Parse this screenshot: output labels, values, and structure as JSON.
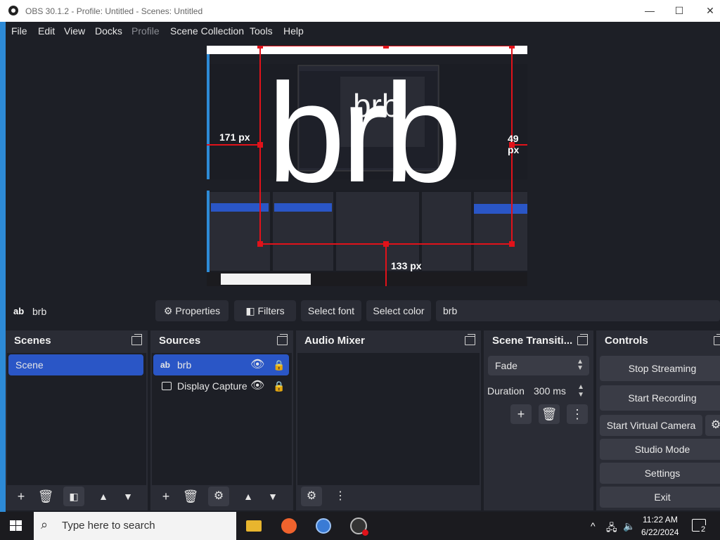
{
  "window": {
    "title": "OBS 30.1.2 - Profile: Untitled - Scenes: Untitled",
    "controls": [
      "—",
      "☐",
      "✕"
    ]
  },
  "menu": [
    "File",
    "Edit",
    "View",
    "Docks",
    "Profile",
    "Scene Collection",
    "Tools",
    "Help"
  ],
  "preview": {
    "overlay_text": "brb",
    "dim_left": "171 px",
    "dim_right": "49 px",
    "dim_bottom": "133 px",
    "accent": "#e1121a"
  },
  "source_toolbar": {
    "current_source": "brb",
    "source_icon": "ab",
    "properties": "Properties",
    "filters": "Filters",
    "select_font": "Select font",
    "select_color": "Select color",
    "text_value": "brb"
  },
  "docks": {
    "scenes": {
      "title": "Scenes",
      "items": [
        "Scene"
      ]
    },
    "sources": {
      "title": "Sources",
      "items": [
        {
          "name": "brb",
          "icon": "ab"
        },
        {
          "name": "Display Capture",
          "icon": "monitor"
        }
      ]
    },
    "audio_mixer": {
      "title": "Audio Mixer"
    },
    "transitions": {
      "title": "Scene Transiti...",
      "transition": "Fade",
      "duration_label": "Duration",
      "duration_value": "300 ms"
    },
    "controls": {
      "title": "Controls",
      "buttons": [
        "Stop Streaming",
        "Start Recording",
        "Start Virtual Camera",
        "Studio Mode",
        "Settings",
        "Exit"
      ]
    }
  },
  "taskbar": {
    "search_placeholder": "Type here to search",
    "time": "11:22 AM",
    "date": "6/22/2024",
    "notifications": "2"
  },
  "colors": {
    "bg": "#1d1f26",
    "dock": "#2a2c35",
    "selected": "#2a56c6",
    "accent_left": "#2d8ad6"
  }
}
